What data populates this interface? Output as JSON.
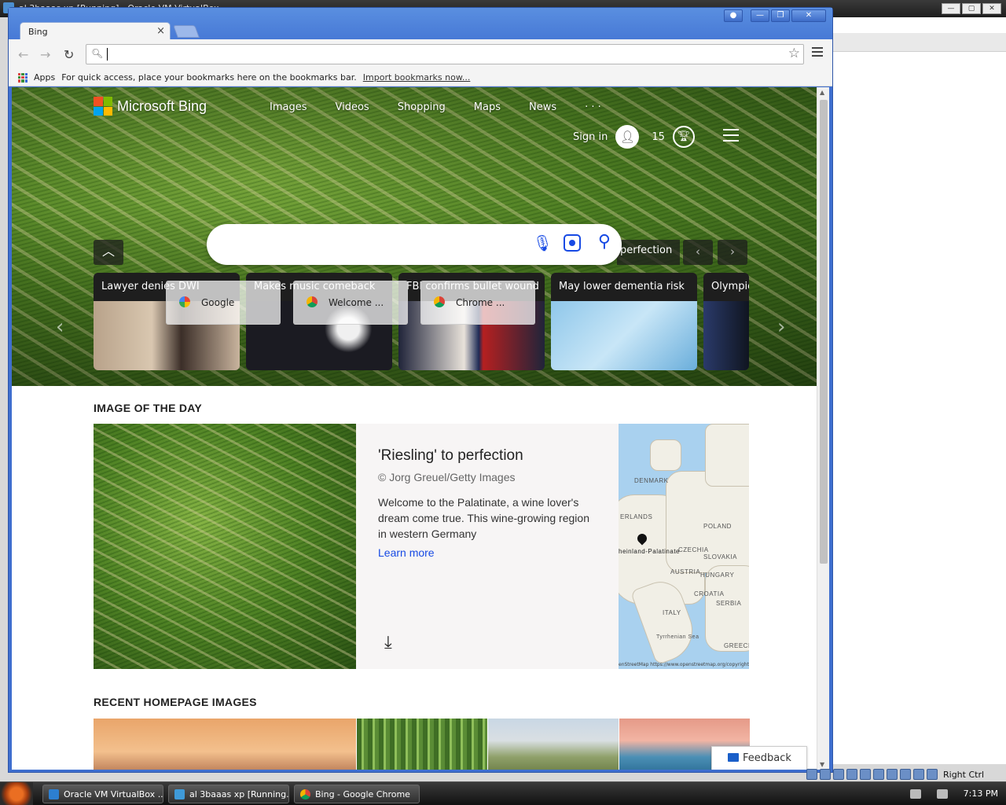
{
  "host": {
    "window_title": "al 3baaas xp [Running] - Oracle VM VirtualBox",
    "status_right": "Right Ctrl"
  },
  "chrome": {
    "tab_title": "Bing",
    "omnibox_value": "",
    "bookmarks": {
      "apps_label": "Apps",
      "hint": "For quick access, place your bookmarks here on the bookmarks bar.",
      "import_link": "Import bookmarks now..."
    }
  },
  "bing": {
    "logo": "Microsoft Bing",
    "nav": [
      "Images",
      "Videos",
      "Shopping",
      "Maps",
      "News",
      "· · ·"
    ],
    "sign_in": "Sign in",
    "points": "15",
    "hero_caption": "perfection",
    "news_cards": [
      "Lawyer denies DWI",
      "Makes music comeback",
      "FBI confirms bullet wound",
      "May lower dementia risk",
      "Olympic"
    ],
    "tab_previews": [
      "Google",
      "Welcome ...",
      "Chrome ..."
    ],
    "iotd": {
      "section_title": "IMAGE OF THE DAY",
      "title": "'Riesling' to perfection",
      "credit": "© Jorg Greuel/Getty Images",
      "description": "Welcome to the Palatinate, a wine lover's dream come true. This wine-growing region in western Germany",
      "learn_more": "Learn more"
    },
    "map_labels": {
      "denmark": "DENMARK",
      "poland": "POLAND",
      "netherlands": "ERLANDS",
      "czechia": "CZECHIA",
      "slovakia": "SLOVAKIA",
      "austria": "AUSTRIA",
      "hungary": "HUNGARY",
      "croatia": "CROATIA",
      "serbia": "SERBIA",
      "italy": "ITALY",
      "tyrrhenian": "Tyrrhenian Sea",
      "greece": "GREECE",
      "pin": "heinland-Palatinate",
      "attribution": "enStreetMap https://www.openstreetmap.org/copyright  © 2024 TomTom"
    },
    "recent_title": "RECENT HOMEPAGE IMAGES",
    "feedback": "Feedback"
  },
  "taskbar": {
    "items": [
      "Oracle VM VirtualBox ...",
      "al 3baaas xp [Running...",
      "Bing - Google Chrome"
    ],
    "clock": "7:13 PM"
  }
}
